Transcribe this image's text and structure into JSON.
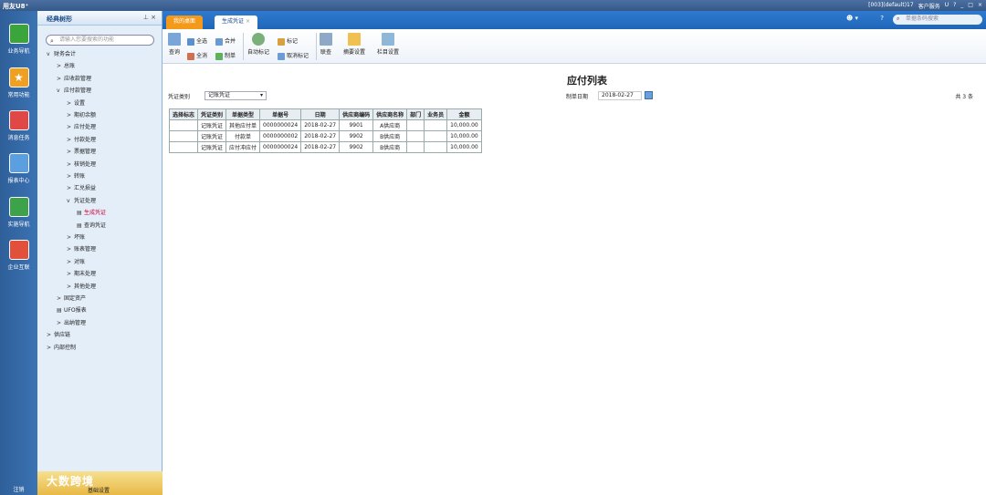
{
  "app": {
    "title": "用友U8⁺",
    "right": [
      "[003](default)17",
      "客户服务",
      "U",
      "?",
      "_",
      "□",
      "×"
    ]
  },
  "leftbar": [
    "业务导航",
    "常用功能",
    "消息任务",
    "报表中心",
    "实施导航",
    "企业互联",
    "注销"
  ],
  "tree": {
    "title": "经典树形",
    "search_placeholder": "请输入您要搜索的功能",
    "nodes": [
      {
        "label": "财务会计",
        "arrow": "v",
        "indent": 1
      },
      {
        "label": "总账",
        "arrow": ">",
        "indent": 2
      },
      {
        "label": "应收款管理",
        "arrow": ">",
        "indent": 2
      },
      {
        "label": "应付款管理",
        "arrow": "v",
        "indent": 2
      },
      {
        "label": "设置",
        "arrow": ">",
        "indent": 3
      },
      {
        "label": "期初余额",
        "arrow": ">",
        "indent": 3
      },
      {
        "label": "应付处理",
        "arrow": ">",
        "indent": 3
      },
      {
        "label": "付款处理",
        "arrow": ">",
        "indent": 3
      },
      {
        "label": "票据管理",
        "arrow": ">",
        "indent": 3
      },
      {
        "label": "核销处理",
        "arrow": ">",
        "indent": 3
      },
      {
        "label": "转账",
        "arrow": ">",
        "indent": 3
      },
      {
        "label": "汇兑损益",
        "arrow": ">",
        "indent": 3
      },
      {
        "label": "凭证处理",
        "arrow": "v",
        "indent": 3
      },
      {
        "label": "生成凭证",
        "arrow": "▤",
        "indent": 4,
        "selected": true
      },
      {
        "label": "查询凭证",
        "arrow": "▤",
        "indent": 4
      },
      {
        "label": "坏账",
        "arrow": ">",
        "indent": 3
      },
      {
        "label": "账表管理",
        "arrow": ">",
        "indent": 3
      },
      {
        "label": "对账",
        "arrow": ">",
        "indent": 3
      },
      {
        "label": "期末处理",
        "arrow": ">",
        "indent": 3
      },
      {
        "label": "其他处理",
        "arrow": ">",
        "indent": 3
      },
      {
        "label": "固定资产",
        "arrow": ">",
        "indent": 2
      },
      {
        "label": "UFO报表",
        "arrow": "▤",
        "indent": 2
      },
      {
        "label": "出纳管理",
        "arrow": ">",
        "indent": 2
      },
      {
        "label": "供应链",
        "arrow": ">",
        "indent": 1
      },
      {
        "label": "内部控制",
        "arrow": ">",
        "indent": 1
      }
    ],
    "footer": "基础设置"
  },
  "tabs": {
    "desk": "我的桌面",
    "active": "生成凭证",
    "search_placeholder": "单据条码搜索"
  },
  "toolbar": {
    "query": "查询",
    "select_all": "全选",
    "deselect_all": "全消",
    "merge": "合并",
    "make": "制单",
    "auto_mark": "自动标记",
    "mark": "标记",
    "cancel_mark": "取消标记",
    "link": "联查",
    "summary": "摘要设置",
    "columns": "栏目设置"
  },
  "page": {
    "title": "应付列表",
    "voucher_type_label": "凭证类别",
    "voucher_type_value": "记账凭证",
    "date_label": "制单日期",
    "date_value": "2018-02-27",
    "count": "共 3 条"
  },
  "grid": {
    "headers": [
      "选择标志",
      "凭证类别",
      "单据类型",
      "单据号",
      "日期",
      "供应商编码",
      "供应商名称",
      "部门",
      "业务员",
      "金额"
    ],
    "rows": [
      [
        "",
        "记账凭证",
        "其他应付单",
        "0000000024",
        "2018-02-27",
        "9901",
        "A供应商",
        "",
        "",
        "10,000.00"
      ],
      [
        "",
        "记账凭证",
        "付款单",
        "0000000002",
        "2018-02-27",
        "9902",
        "B供应商",
        "",
        "",
        "10,000.00"
      ],
      [
        "",
        "记账凭证",
        "应付冲应付",
        "0000000024",
        "2018-02-27",
        "9902",
        "B供应商",
        "",
        "",
        "10,000.00"
      ]
    ]
  },
  "watermark": "大数跨境"
}
